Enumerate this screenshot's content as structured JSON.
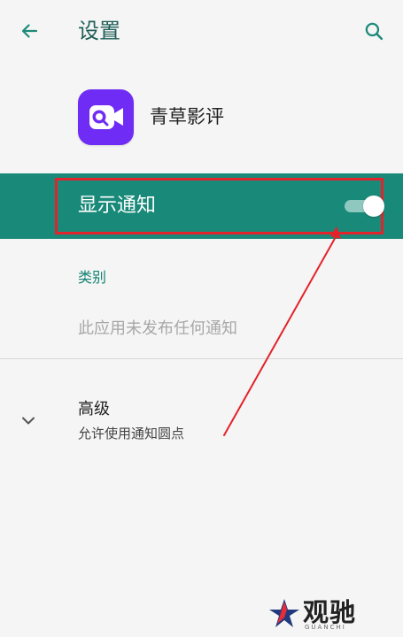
{
  "header": {
    "title": "设置",
    "back_icon": "back-arrow-icon",
    "search_icon": "search-icon"
  },
  "app": {
    "name": "青草影评",
    "icon": "video-camera-icon",
    "icon_color": "#6f2cf4"
  },
  "notification": {
    "label": "显示通知",
    "enabled": true,
    "accent_color": "#198a79",
    "highlight_color": "#e3232b"
  },
  "category": {
    "label": "类别",
    "empty_text": "此应用未发布任何通知"
  },
  "advanced": {
    "title": "高级",
    "subtitle": "允许使用通知圆点",
    "chevron_icon": "chevron-down-icon"
  },
  "watermark": {
    "main": "观驰",
    "sub": "GUANCHI"
  }
}
